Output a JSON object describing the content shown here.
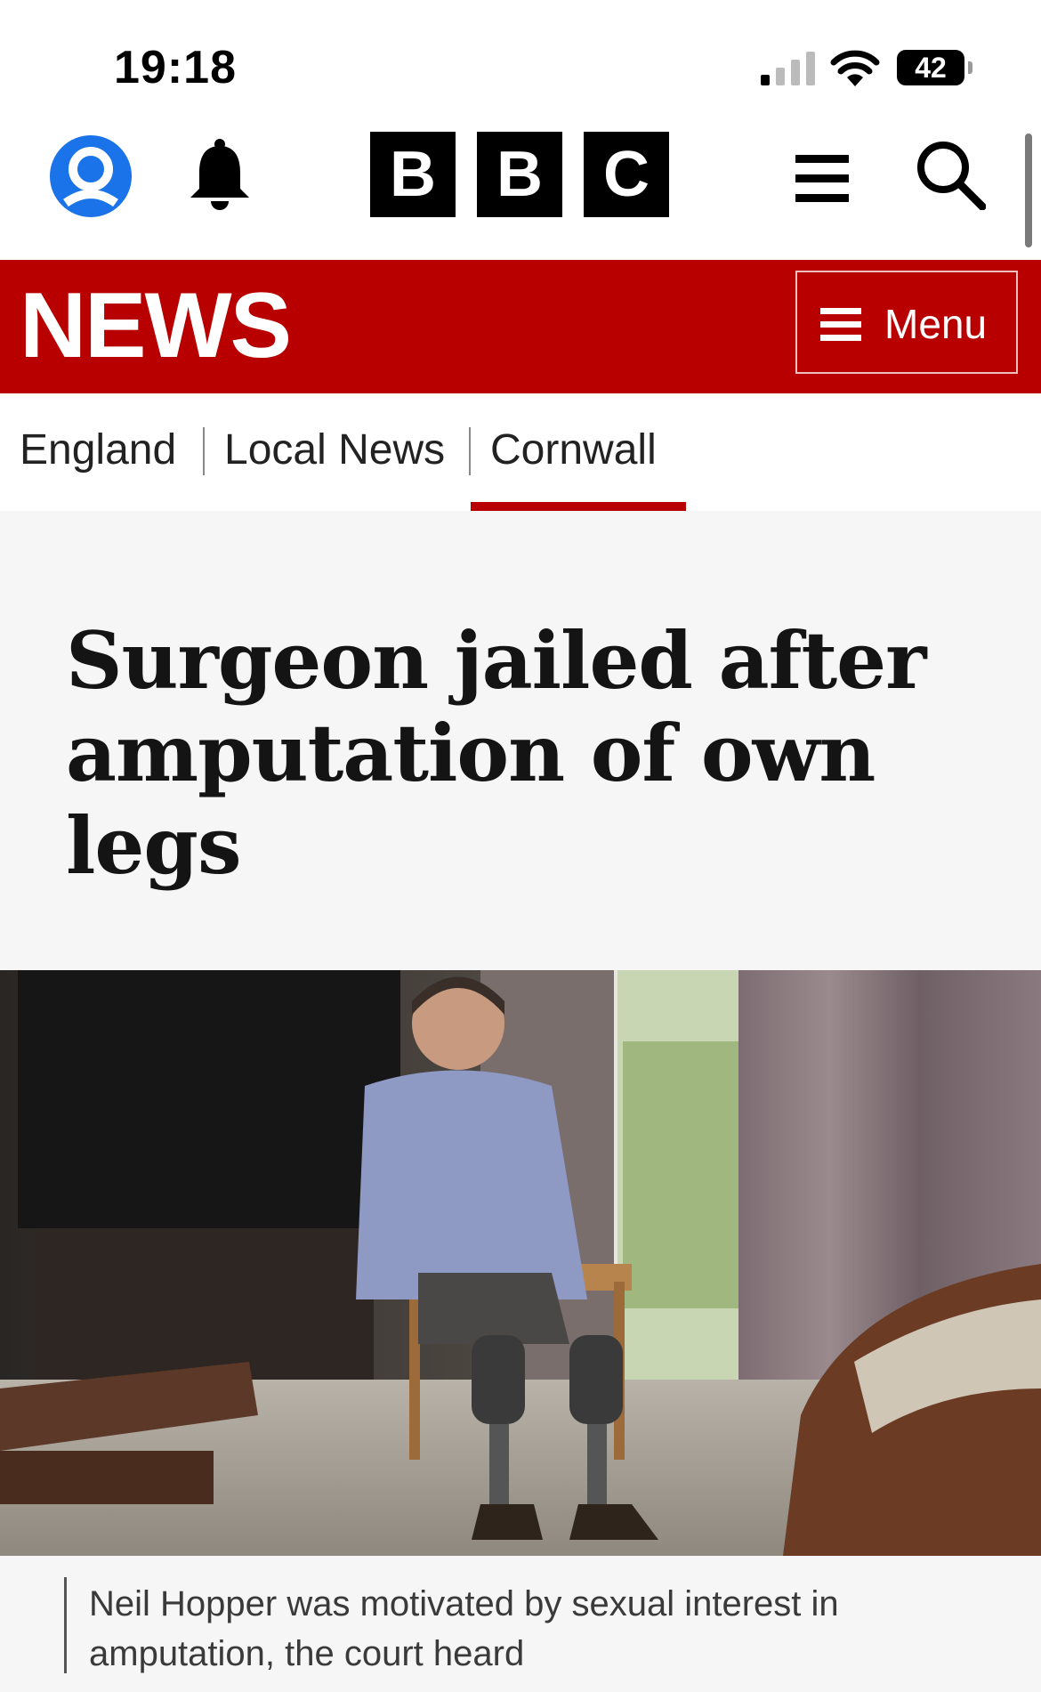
{
  "status_bar": {
    "time": "19:18",
    "battery": "42"
  },
  "top_bar": {
    "logo_letters": [
      "B",
      "B",
      "C"
    ],
    "icons": [
      "account-icon",
      "bell-icon",
      "hamburger-icon",
      "search-icon"
    ]
  },
  "news_bar": {
    "title": "NEWS",
    "menu_label": "Menu",
    "color": "#b80000"
  },
  "breadcrumb": {
    "items": [
      {
        "label": "England"
      },
      {
        "label": "Local News"
      },
      {
        "label": "Cornwall",
        "active": true
      }
    ]
  },
  "article": {
    "headline": "Surgeon jailed after amputation of own legs",
    "image_caption": "Neil Hopper was motivated by sexual interest in amputation, the court heard"
  }
}
